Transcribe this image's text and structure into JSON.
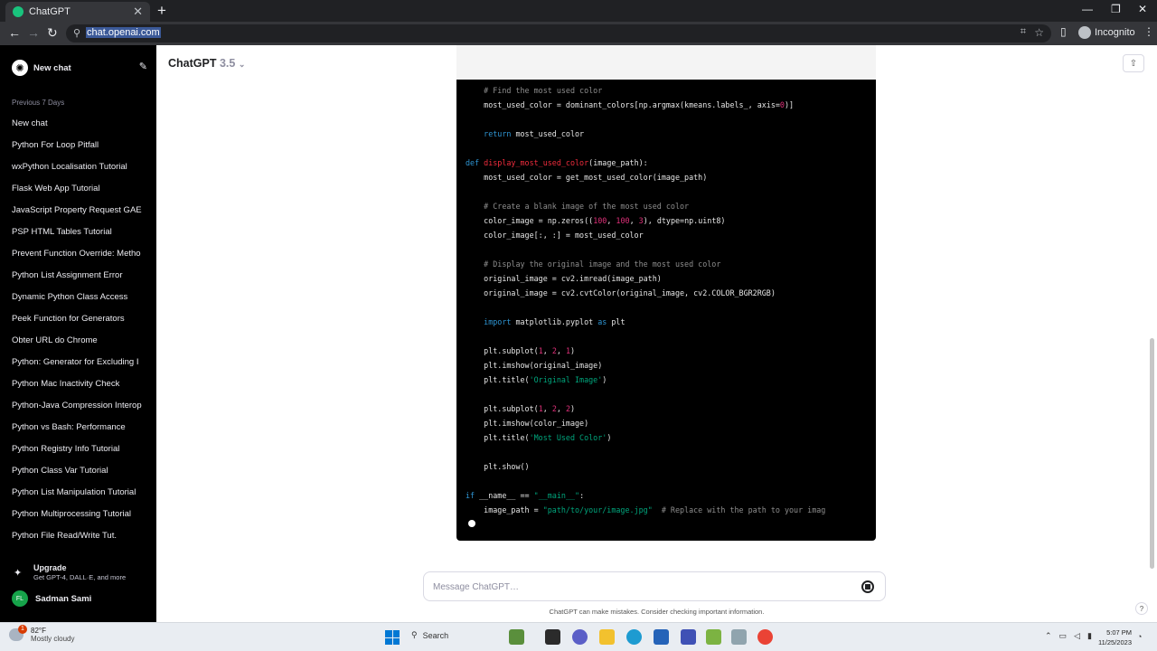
{
  "browser": {
    "tab_title": "ChatGPT",
    "url": "chat.openai.com",
    "profile": "Incognito"
  },
  "sidebar": {
    "new_chat": "New chat",
    "section": "Previous 7 Days",
    "items": [
      "New chat",
      "Python For Loop Pitfall",
      "wxPython Localisation Tutorial",
      "Flask Web App Tutorial",
      "JavaScript Property Request GAE",
      "PSP HTML Tables Tutorial",
      "Prevent Function Override: Metho",
      "Python List Assignment Error",
      "Dynamic Python Class Access",
      "Peek Function for Generators",
      "Obter URL do Chrome",
      "Python: Generator for Excluding I",
      "Python Mac Inactivity Check",
      "Python-Java Compression Interop",
      "Python vs Bash: Performance",
      "Python Registry Info Tutorial",
      "Python Class Var Tutorial",
      "Python List Manipulation Tutorial",
      "Python Multiprocessing Tutorial",
      "Python File Read/Write Tut."
    ],
    "upgrade_title": "Upgrade",
    "upgrade_sub": "Get GPT-4, DALL·E, and more",
    "user_initials": "FL",
    "user_name": "Sadman Sami"
  },
  "header": {
    "model": "ChatGPT",
    "version": "3.5"
  },
  "code": {
    "lines": [
      [
        [
          "c-cm",
          "    # Find the most used color"
        ]
      ],
      [
        [
          "",
          "    most_used_color = dominant_colors[np.argmax(kmeans.labels_, axis="
        ],
        [
          "c-nm",
          "0"
        ],
        [
          "",
          ")]"
        ]
      ],
      [
        [
          "",
          ""
        ]
      ],
      [
        [
          "c-kw",
          "    return"
        ],
        [
          "",
          " most_used_color"
        ]
      ],
      [
        [
          "",
          ""
        ]
      ],
      [
        [
          "c-kw",
          "def "
        ],
        [
          "c-fn",
          "display_most_used_color"
        ],
        [
          "",
          "(image_path):"
        ]
      ],
      [
        [
          "",
          "    most_used_color = get_most_used_color(image_path)"
        ]
      ],
      [
        [
          "",
          ""
        ]
      ],
      [
        [
          "c-cm",
          "    # Create a blank image of the most used color"
        ]
      ],
      [
        [
          "",
          "    color_image = np.zeros(("
        ],
        [
          "c-nm",
          "100"
        ],
        [
          "",
          ", "
        ],
        [
          "c-nm",
          "100"
        ],
        [
          "",
          ", "
        ],
        [
          "c-nm",
          "3"
        ],
        [
          "",
          "), dtype=np.uint8)"
        ]
      ],
      [
        [
          "",
          "    color_image[:, :] = most_used_color"
        ]
      ],
      [
        [
          "",
          ""
        ]
      ],
      [
        [
          "c-cm",
          "    # Display the original image and the most used color"
        ]
      ],
      [
        [
          "",
          "    original_image = cv2.imread(image_path)"
        ]
      ],
      [
        [
          "",
          "    original_image = cv2.cvtColor(original_image, cv2.COLOR_BGR2RGB)"
        ]
      ],
      [
        [
          "",
          ""
        ]
      ],
      [
        [
          "c-kw",
          "    import"
        ],
        [
          "",
          " matplotlib.pyplot "
        ],
        [
          "c-kw",
          "as"
        ],
        [
          "",
          " plt"
        ]
      ],
      [
        [
          "",
          ""
        ]
      ],
      [
        [
          "",
          "    plt.subplot("
        ],
        [
          "c-nm",
          "1"
        ],
        [
          "",
          ", "
        ],
        [
          "c-nm",
          "2"
        ],
        [
          "",
          ", "
        ],
        [
          "c-nm",
          "1"
        ],
        [
          "",
          ")"
        ]
      ],
      [
        [
          "",
          "    plt.imshow(original_image)"
        ]
      ],
      [
        [
          "",
          "    plt.title("
        ],
        [
          "c-st",
          "'Original Image'"
        ],
        [
          "",
          ")"
        ]
      ],
      [
        [
          "",
          ""
        ]
      ],
      [
        [
          "",
          "    plt.subplot("
        ],
        [
          "c-nm",
          "1"
        ],
        [
          "",
          ", "
        ],
        [
          "c-nm",
          "2"
        ],
        [
          "",
          ", "
        ],
        [
          "c-nm",
          "2"
        ],
        [
          "",
          ")"
        ]
      ],
      [
        [
          "",
          "    plt.imshow(color_image)"
        ]
      ],
      [
        [
          "",
          "    plt.title("
        ],
        [
          "c-st",
          "'Most Used Color'"
        ],
        [
          "",
          ")"
        ]
      ],
      [
        [
          "",
          ""
        ]
      ],
      [
        [
          "",
          "    plt.show()"
        ]
      ],
      [
        [
          "",
          ""
        ]
      ],
      [
        [
          "c-kw",
          "if"
        ],
        [
          "",
          " __name__ == "
        ],
        [
          "c-st",
          "\"__main__\""
        ],
        [
          "",
          ":"
        ]
      ],
      [
        [
          "",
          "    image_path = "
        ],
        [
          "c-st",
          "\"path/to/your/image.jpg\""
        ],
        [
          "c-cm",
          "  # Replace with the path to your imag"
        ]
      ]
    ]
  },
  "composer": {
    "placeholder": "Message ChatGPT…"
  },
  "disclaimer": "ChatGPT can make mistakes. Consider checking important information.",
  "taskbar": {
    "temp": "82°F",
    "weather": "Mostly cloudy",
    "weather_badge": "1",
    "search": "Search",
    "time": "5:07 PM",
    "date": "11/25/2023"
  }
}
